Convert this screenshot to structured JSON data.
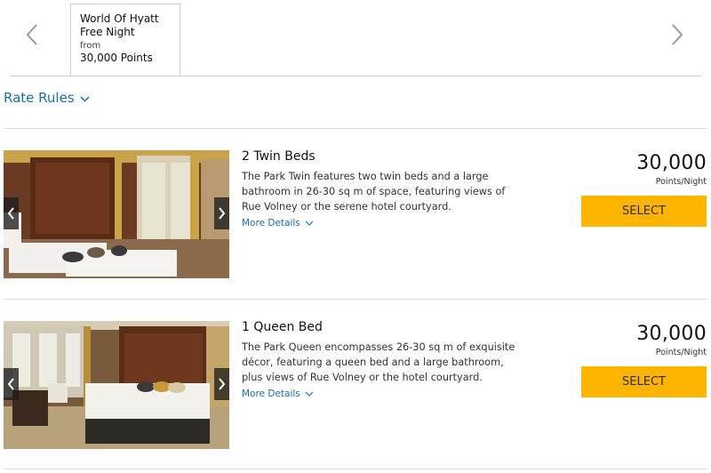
{
  "rate_tabs": {
    "active": {
      "line1": "World Of Hyatt",
      "line2": "Free Night",
      "from_label": "from",
      "points": "30,000 Points"
    },
    "prev_icon": "chevron-left-icon",
    "next_icon": "chevron-right-icon"
  },
  "rate_rules": {
    "label": "Rate Rules",
    "icon": "chevron-down-icon"
  },
  "rooms": [
    {
      "title": "2 Twin Beds",
      "description": "The Park Twin features two twin beds and a large bathroom in 26-30 sq m of space, featuring views of Rue Volney or the serene hotel courtyard.",
      "more_details": "More Details",
      "points": "30,000",
      "points_unit": "Points/Night",
      "select_label": "SELECT"
    },
    {
      "title": "1 Queen Bed",
      "description": "The Park Queen encompasses 26-30 sq m of exquisite décor, featuring a queen bed and a large bathroom, plus views of Rue Volney or the hotel courtyard.",
      "more_details": "More Details",
      "points": "30,000",
      "points_unit": "Points/Night",
      "select_label": "SELECT"
    }
  ],
  "colors": {
    "accent_link": "#1f6fa8",
    "select_button": "#ffb400",
    "divider": "#dcdcdc"
  }
}
